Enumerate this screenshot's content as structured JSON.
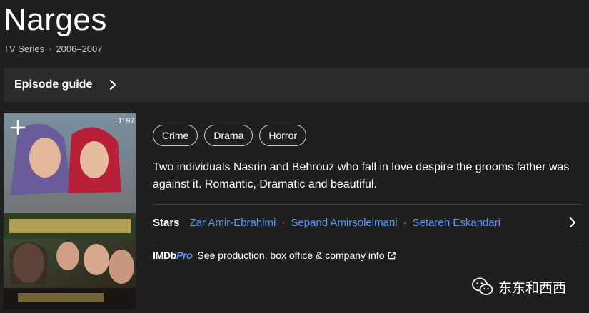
{
  "title": "Narges",
  "meta": {
    "type": "TV Series",
    "separator": "·",
    "years": "2006–2007"
  },
  "episode_guide": {
    "label": "Episode guide"
  },
  "poster": {
    "corner_number": "1197"
  },
  "genres": [
    "Crime",
    "Drama",
    "Horror"
  ],
  "plot": "Two individuals Nasrin and Behrouz who fall in love despire the grooms father was against it. Romantic, Dramatic and beautiful.",
  "stars": {
    "label": "Stars",
    "names": [
      "Zar Amir-Ebrahimi",
      "Sepand Amirsoleimani",
      "Setareh Eskandari"
    ],
    "separator": "·"
  },
  "imdbpro": {
    "logo_main": "IMDb",
    "logo_pro": "Pro",
    "link_text": "See production, box office & company info"
  },
  "watermark": {
    "text": "东东和西西"
  },
  "colors": {
    "background": "#1f1f1f",
    "bar": "#2b2b2b",
    "link": "#5799ef",
    "chip_border": "#cfcfcf"
  },
  "icons": {
    "episode_chevron": "chevron-right-icon",
    "add": "plus-icon",
    "stars_chevron": "chevron-right-icon",
    "external": "external-link-icon",
    "watermark": "wechat-icon"
  }
}
